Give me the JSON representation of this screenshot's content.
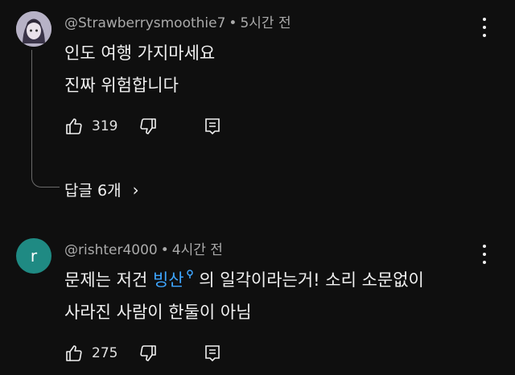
{
  "comments": [
    {
      "author": "@Strawberrysmoothie7",
      "separator": "•",
      "time": "5시간 전",
      "line1": "인도 여행 가지마세요",
      "line2": "진짜 위험합니다",
      "likes": "319",
      "replies_label": "답글 6개"
    },
    {
      "avatar_letter": "r",
      "author": "@rishter4000",
      "separator": "•",
      "time": "4시간 전",
      "line1_before": "문제는 저건 ",
      "line1_link": "빙산",
      "line1_after": " 의 일각이라는거! 소리 소문없이",
      "line2": "사라진 사람이 한둘이 아님",
      "likes": "275"
    }
  ],
  "colors": {
    "background": "#0f0f0f",
    "link": "#3ea6ff",
    "avatar2": "#1f8a83"
  },
  "icons": [
    "like-icon",
    "dislike-icon",
    "reply-icon",
    "more-vert-icon",
    "chevron-right-icon",
    "search-icon"
  ]
}
